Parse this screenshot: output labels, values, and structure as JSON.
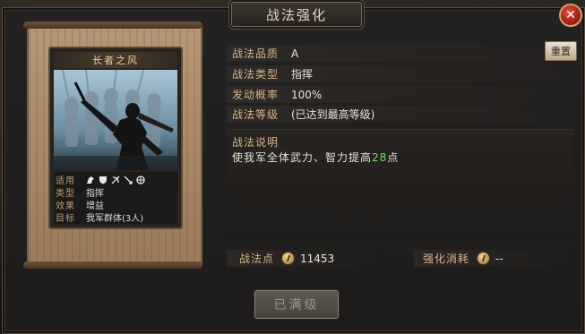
{
  "dialog": {
    "title": "战法强化"
  },
  "card": {
    "name": "长者之风",
    "info": [
      {
        "label": "适用",
        "value": ""
      },
      {
        "label": "类型",
        "value": "指挥"
      },
      {
        "label": "效果",
        "value": "增益"
      },
      {
        "label": "目标",
        "value": "我军群体(3人)"
      }
    ],
    "unit_icons": [
      "cavalry-icon",
      "shield-icon",
      "bow-icon",
      "spear-icon",
      "siege-icon"
    ]
  },
  "tactic": {
    "rows": [
      {
        "label": "战法品质",
        "value": "A"
      },
      {
        "label": "战法类型",
        "value": "指挥"
      },
      {
        "label": "发动概率",
        "value": "100%"
      },
      {
        "label": "战法等级",
        "value": "(已达到最高等级)"
      }
    ],
    "reset_label": "重置",
    "desc_title": "战法说明",
    "desc_prefix": "使我军全体武力、智力提高",
    "desc_number": "28",
    "desc_suffix": "点"
  },
  "points": {
    "label": "战法点",
    "value": "11453"
  },
  "cost": {
    "label": "强化消耗",
    "value": "--"
  },
  "max_button_label": "已满级",
  "colors": {
    "highlight": "#7fdc6a",
    "label_gold": "#d7b58a",
    "close_red": "#b3261a"
  }
}
